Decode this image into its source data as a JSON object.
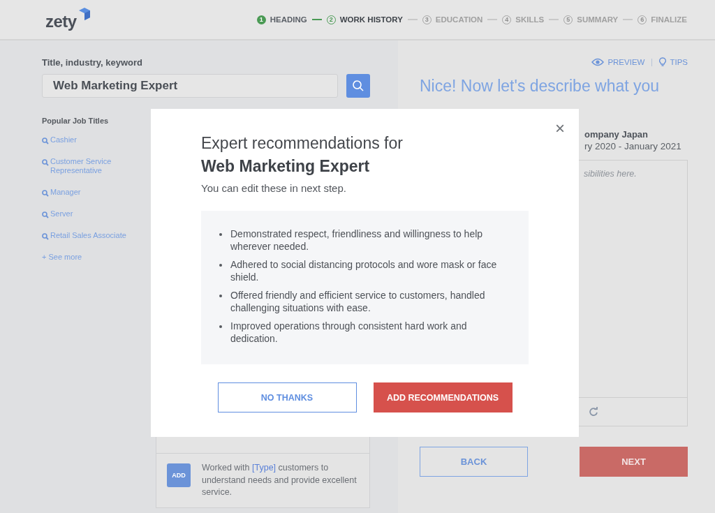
{
  "header": {
    "logo": "zety",
    "steps": [
      {
        "number": "1",
        "label": "HEADING",
        "completed": true,
        "selected": false
      },
      {
        "number": "2",
        "label": "WORK HISTORY",
        "completed": false,
        "selected": true
      },
      {
        "number": "3",
        "label": "EDUCATION",
        "completed": false,
        "selected": false
      },
      {
        "number": "4",
        "label": "SKILLS",
        "completed": false,
        "selected": false
      },
      {
        "number": "5",
        "label": "SUMMARY",
        "completed": false,
        "selected": false
      },
      {
        "number": "6",
        "label": "FINALIZE",
        "completed": false,
        "selected": false
      }
    ]
  },
  "search": {
    "label": "Title, industry, keyword",
    "value": "Web Marketing Expert"
  },
  "popular": {
    "title": "Popular Job Titles",
    "items": [
      "Cashier",
      "Customer Service Representative",
      "Manager",
      "Server",
      "Retail Sales Associate"
    ],
    "see_more": "+ See more"
  },
  "suggestions": [
    {
      "button": "ADD",
      "text_before": "Worked with ",
      "highlight": "[Type]",
      "text_after": " customers to understand needs and provide excellent service."
    }
  ],
  "right": {
    "preview": "PREVIEW",
    "tips": "TIPS",
    "heading": "Nice! Now let's describe what you",
    "company": "ompany Japan",
    "dates": "ry 2020 - January 2021",
    "editor_placeholder": "sibilities here.",
    "back": "BACK",
    "next": "NEXT"
  },
  "modal": {
    "title": "Expert recommendations for",
    "job": "Web Marketing Expert",
    "subtitle": "You can edit these in next step.",
    "close": "×",
    "bullets": [
      "Demonstrated respect, friendliness and willingness to help wherever needed.",
      "Adhered to social distancing protocols and wore mask or face shield.",
      "Offered friendly and efficient service to customers, handled challenging situations with ease.",
      "Improved operations through consistent hard work and dedication."
    ],
    "no_button": "NO THANKS",
    "add_button": "ADD RECOMMENDATIONS"
  }
}
